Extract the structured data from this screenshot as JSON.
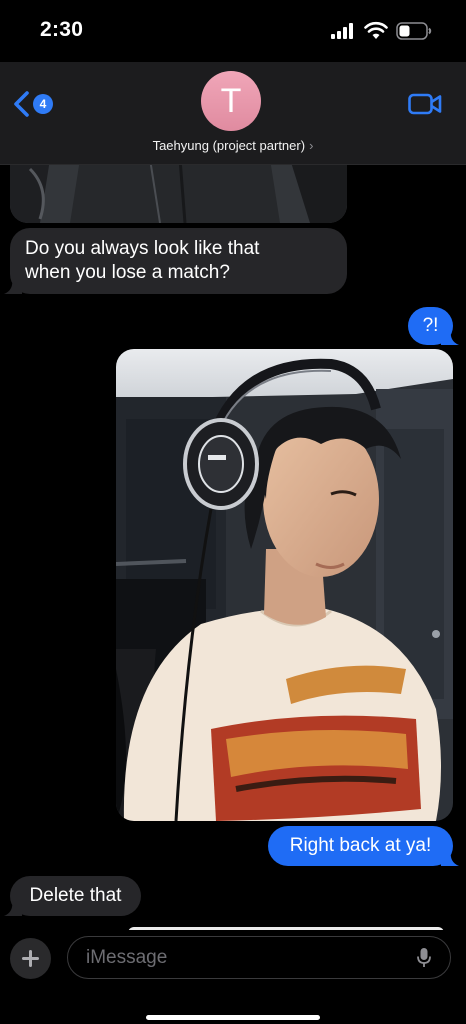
{
  "status": {
    "time": "2:30"
  },
  "header": {
    "back_badge": "4",
    "avatar_initial": "T",
    "contact_name": "Taehyung (project partner)",
    "contact_chevron": "›"
  },
  "messages": [
    {
      "direction": "incoming",
      "type": "photo",
      "description": "partial image (cropped at top)"
    },
    {
      "direction": "incoming",
      "type": "text",
      "line1": "Do you always look like that",
      "line2": "when you lose a match?"
    },
    {
      "direction": "outgoing",
      "type": "text",
      "text": "?!"
    },
    {
      "direction": "outgoing",
      "type": "photo"
    },
    {
      "direction": "outgoing",
      "type": "text",
      "text": "Right back at ya!"
    },
    {
      "direction": "incoming",
      "type": "text",
      "text": "Delete that"
    }
  ],
  "composer": {
    "placeholder": "iMessage"
  },
  "icons": {
    "back": "chevron-left-icon",
    "video": "video-camera-icon",
    "add": "plus-icon",
    "mic": "microphone-icon"
  },
  "colors": {
    "accent": "#1f6cf5",
    "incoming_bubble": "#262629",
    "header_bg": "#1c1c1e",
    "avatar": "#e896ab"
  }
}
